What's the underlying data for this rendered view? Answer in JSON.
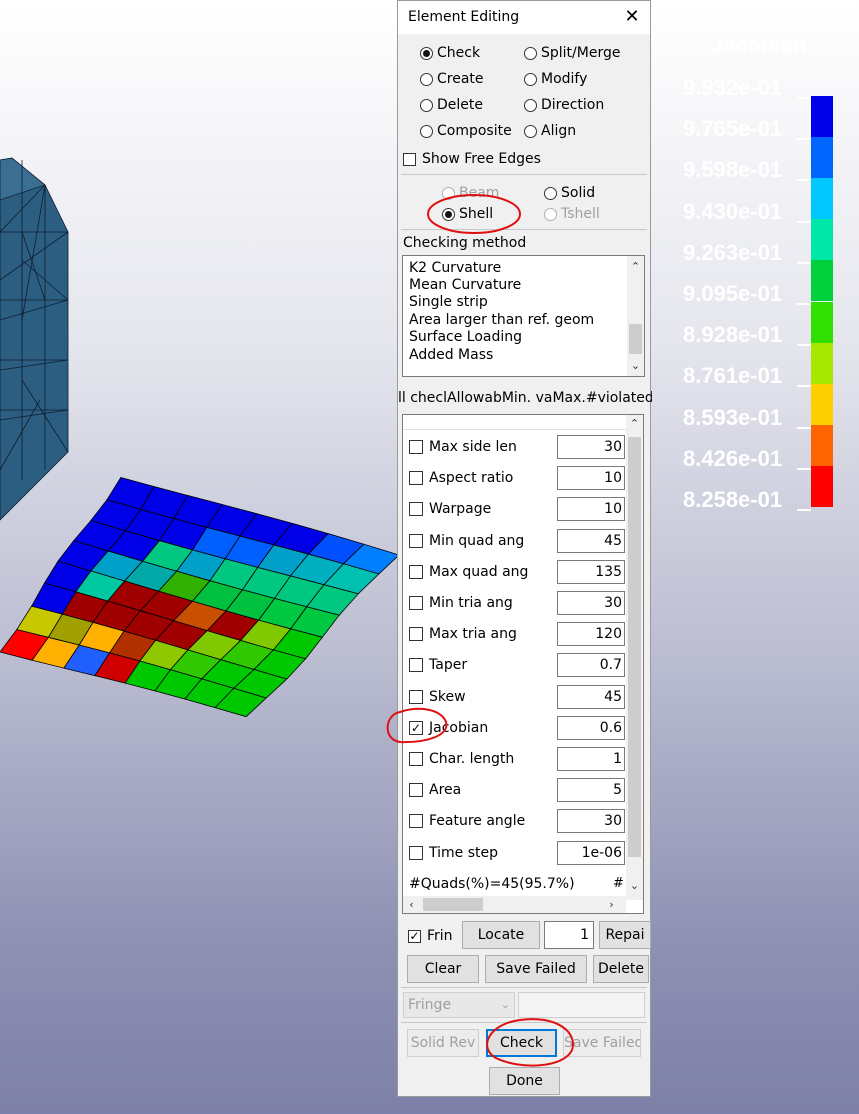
{
  "legend": {
    "title": "Jacobian",
    "labels": [
      "9.932e-01",
      "9.765e-01",
      "9.598e-01",
      "9.430e-01",
      "9.263e-01",
      "9.095e-01",
      "8.928e-01",
      "8.761e-01",
      "8.593e-01",
      "8.426e-01",
      "8.258e-01"
    ],
    "colors": [
      "#0000e8",
      "#0064ff",
      "#00c8ff",
      "#00e8a8",
      "#00d03c",
      "#30e000",
      "#a8e800",
      "#ffd000",
      "#ff6400",
      "#ff0000"
    ]
  },
  "dialog": {
    "title": "Element Editing",
    "modes": [
      {
        "label": "Check",
        "selected": true
      },
      {
        "label": "Split/Merge",
        "selected": false
      },
      {
        "label": "Create",
        "selected": false
      },
      {
        "label": "Modify",
        "selected": false
      },
      {
        "label": "Delete",
        "selected": false
      },
      {
        "label": "Direction",
        "selected": false
      },
      {
        "label": "Composite",
        "selected": false
      },
      {
        "label": "Align",
        "selected": false
      }
    ],
    "show_free_edges": "Show Free Edges",
    "element_types": [
      {
        "label": "Beam",
        "selected": false,
        "disabled": true
      },
      {
        "label": "Solid",
        "selected": false,
        "disabled": false
      },
      {
        "label": "Shell",
        "selected": true,
        "disabled": false
      },
      {
        "label": "Tshell",
        "selected": false,
        "disabled": true
      }
    ],
    "checking_method_label": "Checking method",
    "methods": [
      "K2 Curvature",
      "Mean Curvature",
      "Single strip",
      "Area larger than ref. geom",
      "Surface Loading",
      "Added Mass"
    ],
    "grid_header": "ll checlAllowabMin. vaMax.#violated(%",
    "checks": [
      {
        "label": "Max side len",
        "value": "30",
        "checked": false
      },
      {
        "label": "Aspect ratio",
        "value": "10",
        "checked": false
      },
      {
        "label": "Warpage",
        "value": "10",
        "checked": false
      },
      {
        "label": "Min quad ang",
        "value": "45",
        "checked": false
      },
      {
        "label": "Max quad ang",
        "value": "135",
        "checked": false
      },
      {
        "label": "Min tria ang",
        "value": "30",
        "checked": false
      },
      {
        "label": "Max tria ang",
        "value": "120",
        "checked": false
      },
      {
        "label": "Taper",
        "value": "0.7",
        "checked": false
      },
      {
        "label": "Skew",
        "value": "45",
        "checked": false
      },
      {
        "label": "Jacobian",
        "value": "0.6",
        "checked": true
      },
      {
        "label": "Char. length",
        "value": "1",
        "checked": false
      },
      {
        "label": "Area",
        "value": "5",
        "checked": false
      },
      {
        "label": "Feature angle",
        "value": "30",
        "checked": false
      },
      {
        "label": "Time step",
        "value": "1e-06",
        "checked": false
      }
    ],
    "footer": "#Quads(%)=45(95.7%)",
    "footer_extra": "#",
    "fringe_check": "Frin",
    "locate": "Locate",
    "locate_index": "1",
    "repair": "Repai",
    "clear": "Clear",
    "save_failed": "Save Failed",
    "delete": "Delete",
    "fringe_combo": "Fringe",
    "solid_rev": "Solid Rev",
    "check": "Check",
    "save_failed2": "Save Failed",
    "done": "Done"
  }
}
